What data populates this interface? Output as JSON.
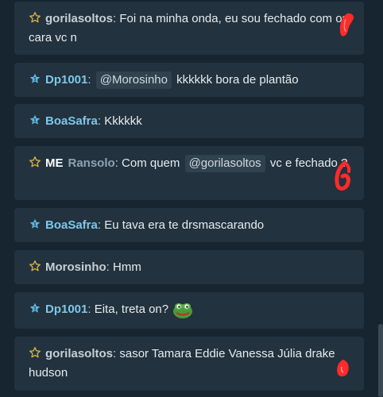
{
  "messages": [
    {
      "author": "gorilasoltos",
      "badge": "",
      "text": "Foi na minha onda, eu sou fechado com os cara vc n",
      "mention": "",
      "text_after": "",
      "star": "gold"
    },
    {
      "author": "Dp1001",
      "badge": "",
      "text": "",
      "mention": "@Morosinho",
      "text_after": "kkkkkk bora de plantão",
      "star": "blue"
    },
    {
      "author": "BoaSafra",
      "badge": "",
      "text": "Kkkkkk",
      "mention": "",
      "text_after": "",
      "star": "blue"
    },
    {
      "author": "Ransolo",
      "badge": "ME",
      "text": "Com quem",
      "mention": "@gorilasoltos",
      "text_after": "vc e fechado ?",
      "star": "gold"
    },
    {
      "author": "BoaSafra",
      "badge": "",
      "text": "Eu tava era te drsmascarando",
      "mention": "",
      "text_after": "",
      "star": "blue"
    },
    {
      "author": "Morosinho",
      "badge": "",
      "text": "Hmm",
      "mention": "",
      "text_after": "",
      "star": "gold"
    },
    {
      "author": "Dp1001",
      "badge": "",
      "text": "Eita, treta on?",
      "mention": "",
      "text_after": "",
      "star": "blue",
      "emoji": "frog-emoji"
    },
    {
      "author": "gorilasoltos",
      "badge": "",
      "text": "sasor Tamara Eddie Vanessa Júlia drake hudson",
      "mention": "",
      "text_after": "",
      "star": "gold"
    }
  ],
  "colors": {
    "background": "#172530",
    "bubble": "#22323e",
    "gold_star": "#d9b24a",
    "blue_star": "#5fb8e0",
    "doodle": "#ff2a2a"
  }
}
